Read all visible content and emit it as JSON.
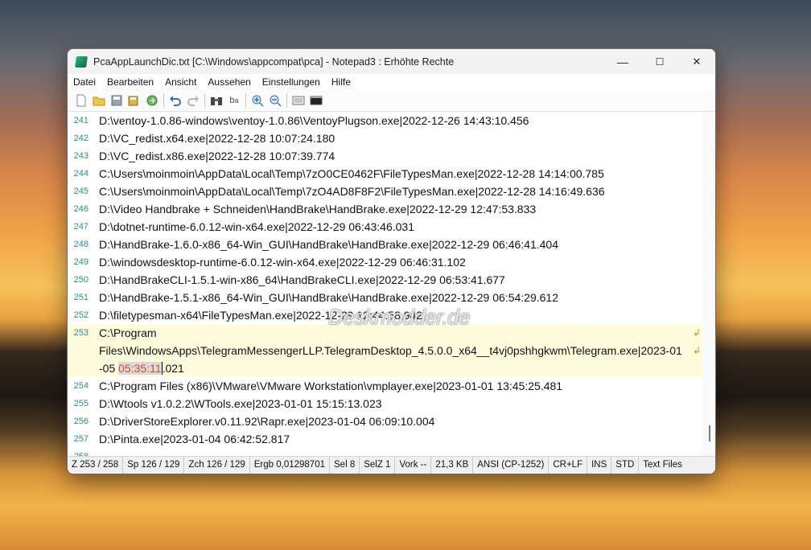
{
  "window": {
    "title": "PcaAppLaunchDic.txt [C:\\Windows\\appcompat\\pca] - Notepad3 : Erhöhte Rechte",
    "minimize": "—",
    "maximize": "☐",
    "close": "✕"
  },
  "menu": [
    "Datei",
    "Bearbeiten",
    "Ansicht",
    "Aussehen",
    "Einstellungen",
    "Hilfe"
  ],
  "toolbar_icons": [
    "new-icon",
    "open-icon",
    "save-icon",
    "save-as-icon",
    "browse-icon",
    "undo-icon",
    "redo-icon",
    "find-icon",
    "replace-icon",
    "zoom-in-icon",
    "zoom-out-icon",
    "scheme-icon",
    "console-icon"
  ],
  "lines": [
    {
      "num": "241",
      "text": "D:\\ventoy-1.0.86-windows\\ventoy-1.0.86\\VentoyPlugson.exe|2022-12-26 14:43:10.456"
    },
    {
      "num": "242",
      "text": "D:\\VC_redist.x64.exe|2022-12-28 10:07:24.180"
    },
    {
      "num": "243",
      "text": "D:\\VC_redist.x86.exe|2022-12-28 10:07:39.774"
    },
    {
      "num": "244",
      "text": "C:\\Users\\moinmoin\\AppData\\Local\\Temp\\7zO0CE0462F\\FileTypesMan.exe|2022-12-28 14:14:00.785"
    },
    {
      "num": "245",
      "text": "C:\\Users\\moinmoin\\AppData\\Local\\Temp\\7zO4AD8F8F2\\FileTypesMan.exe|2022-12-28 14:16:49.636"
    },
    {
      "num": "246",
      "text": "D:\\Video Handbrake + Schneiden\\HandBrake\\HandBrake.exe|2022-12-29 12:47:53.833"
    },
    {
      "num": "247",
      "text": "D:\\dotnet-runtime-6.0.12-win-x64.exe|2022-12-29 06:43:46.031"
    },
    {
      "num": "248",
      "text": "D:\\HandBrake-1.6.0-x86_64-Win_GUI\\HandBrake\\HandBrake.exe|2022-12-29 06:46:41.404"
    },
    {
      "num": "249",
      "text": "D:\\windowsdesktop-runtime-6.0.12-win-x64.exe|2022-12-29 06:46:31.102"
    },
    {
      "num": "250",
      "text": "D:\\HandBrakeCLI-1.5.1-win-x86_64\\HandBrakeCLI.exe|2022-12-29 06:53:41.677"
    },
    {
      "num": "251",
      "text": "D:\\HandBrake-1.5.1-x86_64-Win_GUI\\HandBrake\\HandBrake.exe|2022-12-29 06:54:29.612"
    },
    {
      "num": "252",
      "text": "D:\\filetypesman-x64\\FileTypesMan.exe|2022-12-29 12:44:58.942"
    }
  ],
  "current_line": {
    "num": "253",
    "part1": "C:\\Program",
    "part2": "Files\\WindowsApps\\TelegramMessengerLLP.TelegramDesktop_4.5.0.0_x64__t4vj0pshhgkwm\\Telegram.exe|2023-01",
    "part3_pre": "-05 ",
    "selected": "05:35:11",
    "part3_post": ".021"
  },
  "lines_after": [
    {
      "num": "254",
      "text": "C:\\Program Files (x86)\\VMware\\VMware Workstation\\vmplayer.exe|2023-01-01 13:45:25.481"
    },
    {
      "num": "255",
      "text": "D:\\Wtools v1.0.2.2\\WTools.exe|2023-01-01 15:15:13.023"
    },
    {
      "num": "256",
      "text": "D:\\DriverStoreExplorer.v0.11.92\\Rapr.exe|2023-01-04 06:09:10.004"
    },
    {
      "num": "257",
      "text": "D:\\Pinta.exe|2023-01-04 06:42:52.817"
    },
    {
      "num": "258",
      "text": ""
    }
  ],
  "watermark": "Deskmodder.de",
  "status": {
    "line": "Z  253 / 258",
    "col": "Sp  126 / 129",
    "chars": "Zch  126 / 129",
    "result": "Ergb  0,01298701",
    "sel": "Sel  8",
    "selz": "SelZ  1",
    "occ": "Vork  --",
    "size": "21,3 KB",
    "encoding": "ANSI (CP-1252)",
    "eol": "CR+LF",
    "ovr": "INS",
    "mode": "STD",
    "filetype": "Text Files"
  }
}
